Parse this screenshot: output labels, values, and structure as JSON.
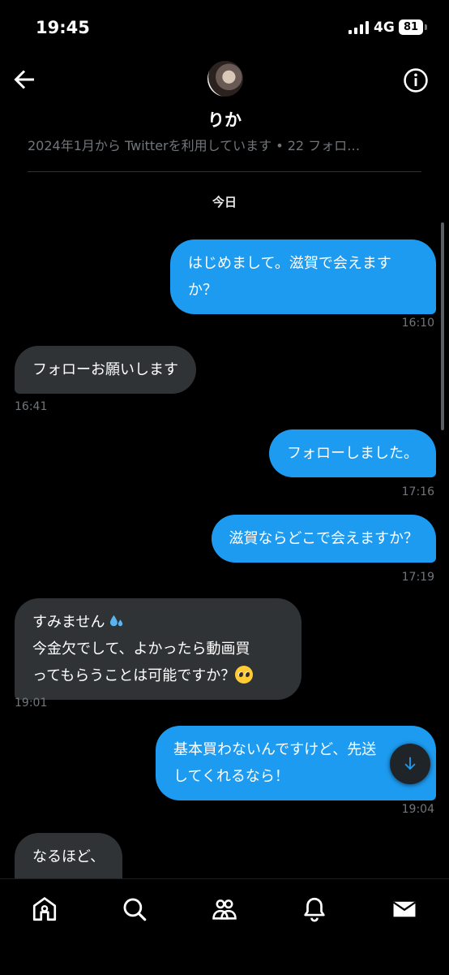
{
  "status_bar": {
    "time": "19:45",
    "network": "4G",
    "battery": "81"
  },
  "header": {
    "contact_name": "りか",
    "profile_meta": "2024年1月から Twitterを利用しています • 22 フォロ…"
  },
  "conversation": {
    "date_label": "今日",
    "messages": [
      {
        "direction": "sent",
        "text": "はじめまして。滋賀で会えますか？",
        "time": "16:10"
      },
      {
        "direction": "received",
        "text": "フォローお願いします",
        "time": "16:41"
      },
      {
        "direction": "sent",
        "text": "フォローしました。",
        "time": "17:16"
      },
      {
        "direction": "sent",
        "text": "滋賀ならどこで会えますか？",
        "time": "17:19"
      },
      {
        "direction": "received",
        "text_line1": "すみません",
        "text_line2": "今金欠でして、よかったら動画買",
        "text_line3": "ってもらうことは可能ですか？",
        "time": "19:01"
      },
      {
        "direction": "sent",
        "text_line1": "基本買わないんですけど、先送",
        "text_line2": "してくれるなら！",
        "time": "19:04"
      },
      {
        "direction": "received",
        "text": "なるほど、"
      }
    ]
  },
  "icons": {
    "back": "back-arrow-icon",
    "info": "info-icon",
    "scroll_down": "arrow-down-icon",
    "tabs": [
      "home-icon",
      "search-icon",
      "communities-icon",
      "notifications-icon",
      "messages-icon"
    ]
  },
  "colors": {
    "sent_bubble": "#1d9bf0",
    "received_bubble": "#2f3336",
    "background": "#000000",
    "muted_text": "#71767b"
  }
}
